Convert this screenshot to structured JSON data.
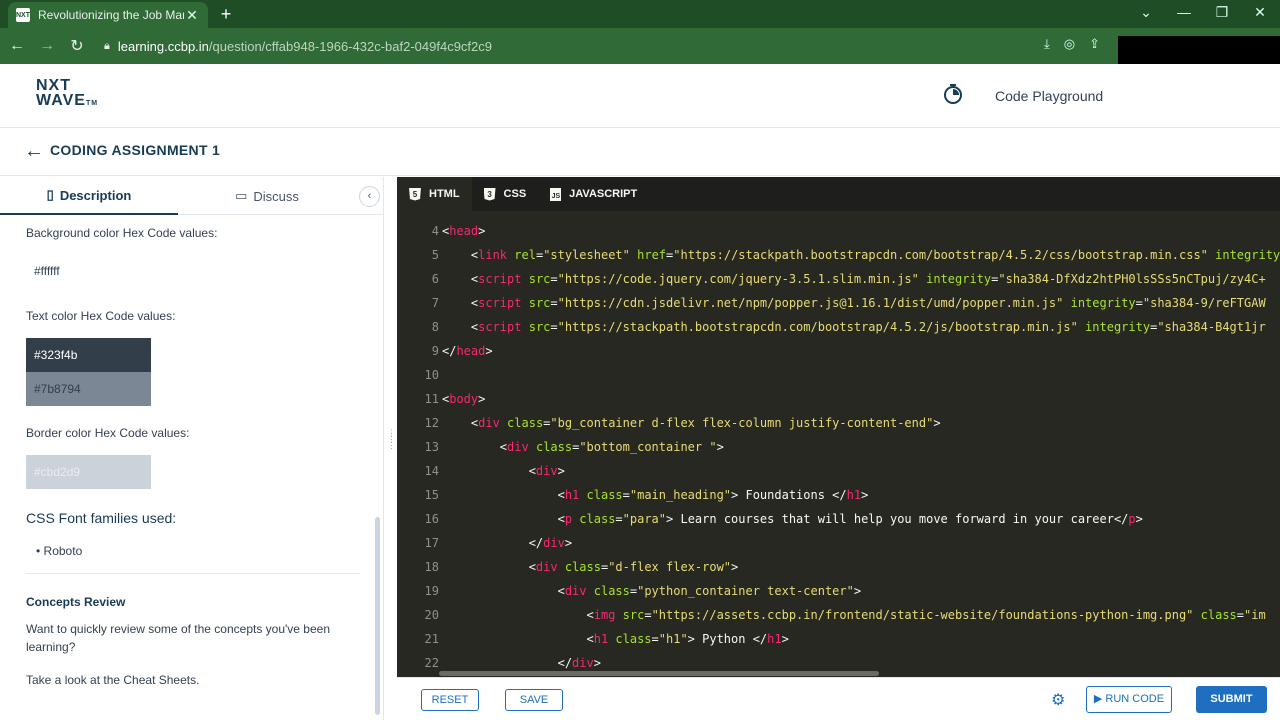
{
  "browser": {
    "tab_title": "Revolutionizing the Job Market |",
    "tab_close": "✕",
    "new_tab": "+",
    "url_host": "learning.ccbp.in",
    "url_path": "/question/cffab948-1966-432c-baf2-049f4c9cf2c9",
    "win_minimize": "—",
    "win_restore": "❐",
    "win_close": "✕",
    "win_dropdown": "⌄"
  },
  "header": {
    "logo_line1": "NXT",
    "logo_line2": "WAVE",
    "logo_tm": "TM",
    "playground_label": "Code Playground"
  },
  "assignment": {
    "back_arrow": "←",
    "title": "CODING ASSIGNMENT 1"
  },
  "left_tabs": {
    "description": "Description",
    "discuss": "Discuss",
    "collapse": "‹"
  },
  "description": {
    "bg_label": "Background color Hex Code values:",
    "bg_value": "#ffffff",
    "text_label": "Text color Hex Code values:",
    "text_value_1": "#323f4b",
    "text_value_2": "#7b8794",
    "border_label": "Border color Hex Code values:",
    "border_value": "#cbd2d9",
    "font_heading": "CSS Font families used:",
    "font_item": "Roboto",
    "concepts_title": "Concepts Review",
    "concepts_para": "Want to quickly review some of the concepts you've been learning?",
    "cheat_para": "Take a look at the Cheat Sheets."
  },
  "colors": {
    "swatch_bg": "#ffffff",
    "swatch_text1": "#323f4b",
    "swatch_text2": "#7b8794",
    "swatch_border": "#cbd2d9",
    "editor_bg": "#272822",
    "accent": "#1e6fbf"
  },
  "editor_tabs": [
    "HTML",
    "CSS",
    "JAVASCRIPT"
  ],
  "line_numbers": [
    "4",
    "5",
    "6",
    "7",
    "8",
    "9",
    "10",
    "11",
    "12",
    "13",
    "14",
    "15",
    "16",
    "17",
    "18",
    "19",
    "20",
    "21",
    "22"
  ],
  "bottom": {
    "reset": "RESET",
    "save": "SAVE",
    "run_code": "RUN CODE",
    "submit": "SUBMIT"
  }
}
